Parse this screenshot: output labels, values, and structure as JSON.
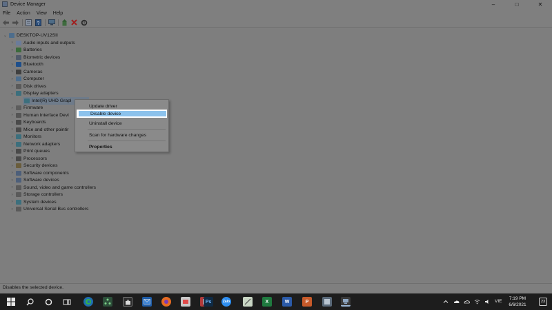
{
  "window": {
    "title": "Device Manager",
    "controls": {
      "minimize": "–",
      "maximize": "□",
      "close": "✕"
    }
  },
  "menubar": [
    "File",
    "Action",
    "View",
    "Help"
  ],
  "toolbar": [
    {
      "icon": "back-arrow-icon"
    },
    {
      "icon": "forward-arrow-icon"
    },
    {
      "icon": "properties-icon"
    },
    {
      "icon": "help-icon"
    },
    {
      "icon": "scan-icon"
    },
    {
      "icon": "update-driver-icon"
    },
    {
      "icon": "uninstall-x-icon"
    },
    {
      "icon": "disable-device-icon"
    }
  ],
  "tree": {
    "root": "DESKTOP-UV12SII",
    "items": [
      {
        "label": "Audio inputs and outputs",
        "icon": "audio-icon",
        "color": "#6b7c9a",
        "expanded": false
      },
      {
        "label": "Batteries",
        "icon": "battery-icon",
        "color": "#3c6b3c",
        "expanded": false
      },
      {
        "label": "Biometric devices",
        "icon": "fingerprint-icon",
        "color": "#505a6a",
        "expanded": false
      },
      {
        "label": "Bluetooth",
        "icon": "bluetooth-icon",
        "color": "#1e4f8c",
        "expanded": false
      },
      {
        "label": "Cameras",
        "icon": "camera-icon",
        "color": "#3f3f3f",
        "expanded": false
      },
      {
        "label": "Computer",
        "icon": "computer-icon",
        "color": "#4d6d8c",
        "expanded": false
      },
      {
        "label": "Disk drives",
        "icon": "disk-icon",
        "color": "#5a5a5a",
        "expanded": false
      },
      {
        "label": "Display adapters",
        "icon": "display-icon",
        "color": "#3c6f7d",
        "expanded": true
      },
      {
        "label": "Intel(R) UHD Graphics",
        "visible_label": "Intel(R) UHD Grapl",
        "icon": "display-icon",
        "color": "#3c6f7d",
        "child": true,
        "selected": true
      },
      {
        "label": "Firmware",
        "icon": "firmware-icon",
        "color": "#5d5d5d",
        "expanded": false
      },
      {
        "label": "Human Interface Devi",
        "icon": "hid-icon",
        "color": "#555",
        "expanded": false
      },
      {
        "label": "Keyboards",
        "icon": "keyboard-icon",
        "color": "#4a4a4a",
        "expanded": false
      },
      {
        "label": "Mice and other pointir",
        "icon": "mouse-icon",
        "color": "#4a4a4a",
        "expanded": false
      },
      {
        "label": "Monitors",
        "icon": "monitor-icon",
        "color": "#3c6f7d",
        "expanded": false
      },
      {
        "label": "Network adapters",
        "icon": "network-icon",
        "color": "#3c6f7d",
        "expanded": false
      },
      {
        "label": "Print queues",
        "icon": "printer-icon",
        "color": "#4a4a4a",
        "expanded": false
      },
      {
        "label": "Processors",
        "icon": "processor-icon",
        "color": "#4a4a4a",
        "expanded": false
      },
      {
        "label": "Security devices",
        "icon": "security-icon",
        "color": "#6a5d3c",
        "expanded": false
      },
      {
        "label": "Software components",
        "icon": "software-icon",
        "color": "#4d5f7a",
        "expanded": false
      },
      {
        "label": "Software devices",
        "icon": "software-icon",
        "color": "#4d5f7a",
        "expanded": false
      },
      {
        "label": "Sound, video and game controllers",
        "icon": "sound-icon",
        "color": "#5a5a5a",
        "expanded": false
      },
      {
        "label": "Storage controllers",
        "icon": "storage-icon",
        "color": "#5a5a5a",
        "expanded": false
      },
      {
        "label": "System devices",
        "icon": "system-icon",
        "color": "#3c6f7d",
        "expanded": false
      },
      {
        "label": "Universal Serial Bus controllers",
        "icon": "usb-icon",
        "color": "#5a5a5a",
        "expanded": false
      }
    ]
  },
  "context_menu": {
    "items": [
      {
        "label": "Update driver"
      },
      {
        "label": "Disable device",
        "highlighted": true
      },
      {
        "label": "Uninstall device"
      },
      {
        "label": "Scan for hardware changes"
      },
      {
        "label": "Properties",
        "bold": true
      }
    ]
  },
  "statusbar": {
    "text": "Disables the selected device."
  },
  "taskbar": {
    "apps": [
      {
        "name": "start-icon"
      },
      {
        "name": "search-icon"
      },
      {
        "name": "task-view-icon"
      },
      {
        "name": "widgets-icon"
      },
      {
        "name": "edge-icon"
      },
      {
        "name": "network-app-icon"
      },
      {
        "name": "store-icon"
      },
      {
        "name": "mail-icon"
      },
      {
        "name": "firefox-icon"
      },
      {
        "name": "app-icon-1"
      },
      {
        "name": "app-icon-2"
      },
      {
        "name": "photoshop-icon",
        "text": "Ps"
      },
      {
        "name": "zalo-icon",
        "text": "Zalo"
      },
      {
        "name": "excel-icon",
        "text": "X"
      },
      {
        "name": "word-icon",
        "text": "W"
      },
      {
        "name": "powerpoint-icon",
        "text": "P"
      },
      {
        "name": "snip-icon"
      },
      {
        "name": "device-manager-taskbar-icon"
      }
    ],
    "tray": {
      "language": "VIE"
    },
    "clock": {
      "time": "7:19 PM",
      "date": "6/6/2021"
    },
    "notifications": "23"
  }
}
